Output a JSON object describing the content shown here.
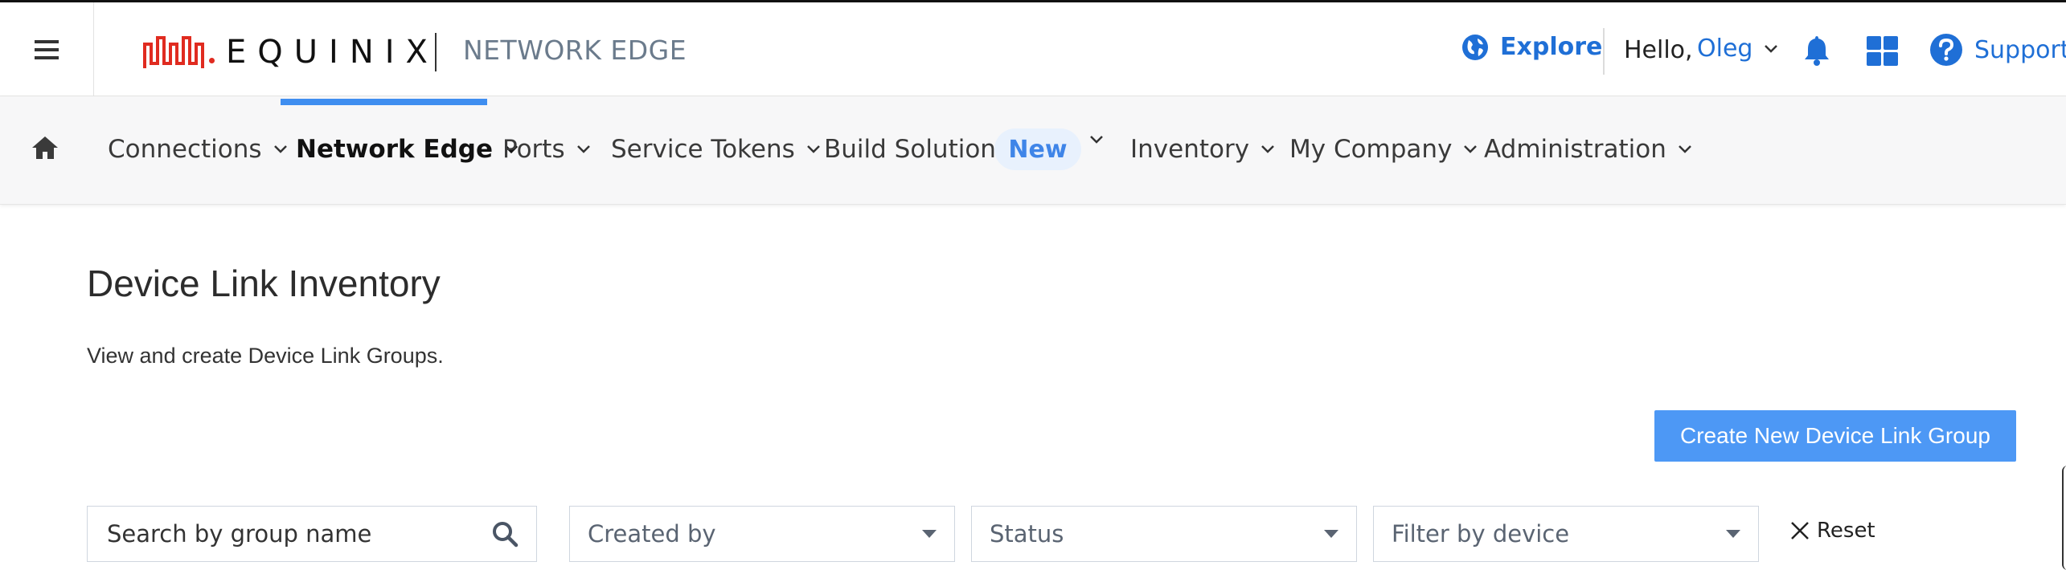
{
  "header": {
    "logo_text": "EQUINIX",
    "product_name": "NETWORK EDGE",
    "explore_label": "Explore",
    "greeting": "Hello,",
    "user_name": "Oleg",
    "support_label": "Support",
    "icons": {
      "menu": "hamburger-icon",
      "explore": "globe-icon",
      "notifications": "bell-icon",
      "apps": "grid-icon",
      "support": "question-circle-icon"
    }
  },
  "nav": {
    "home_icon": "home-icon",
    "items": [
      {
        "label": "Connections"
      },
      {
        "label": "Network Edge",
        "active": true
      },
      {
        "label": "Ports"
      },
      {
        "label": "Service Tokens"
      },
      {
        "label": "Build Solutions",
        "badge": "New"
      },
      {
        "label": "Inventory"
      },
      {
        "label": "My Company"
      },
      {
        "label": "Administration"
      }
    ]
  },
  "page": {
    "title": "Device Link Inventory",
    "subtitle": "View and create Device Link Groups.",
    "create_button": "Create New Device Link Group"
  },
  "filters": {
    "search_placeholder": "Search by group name",
    "created_by": "Created by",
    "status": "Status",
    "device": "Filter by device",
    "reset": "Reset"
  },
  "colors": {
    "accent": "#1f6fd6",
    "brand_red": "#e02b20",
    "primary_button": "#4d98f5",
    "active_indicator": "#3f8ef0"
  }
}
